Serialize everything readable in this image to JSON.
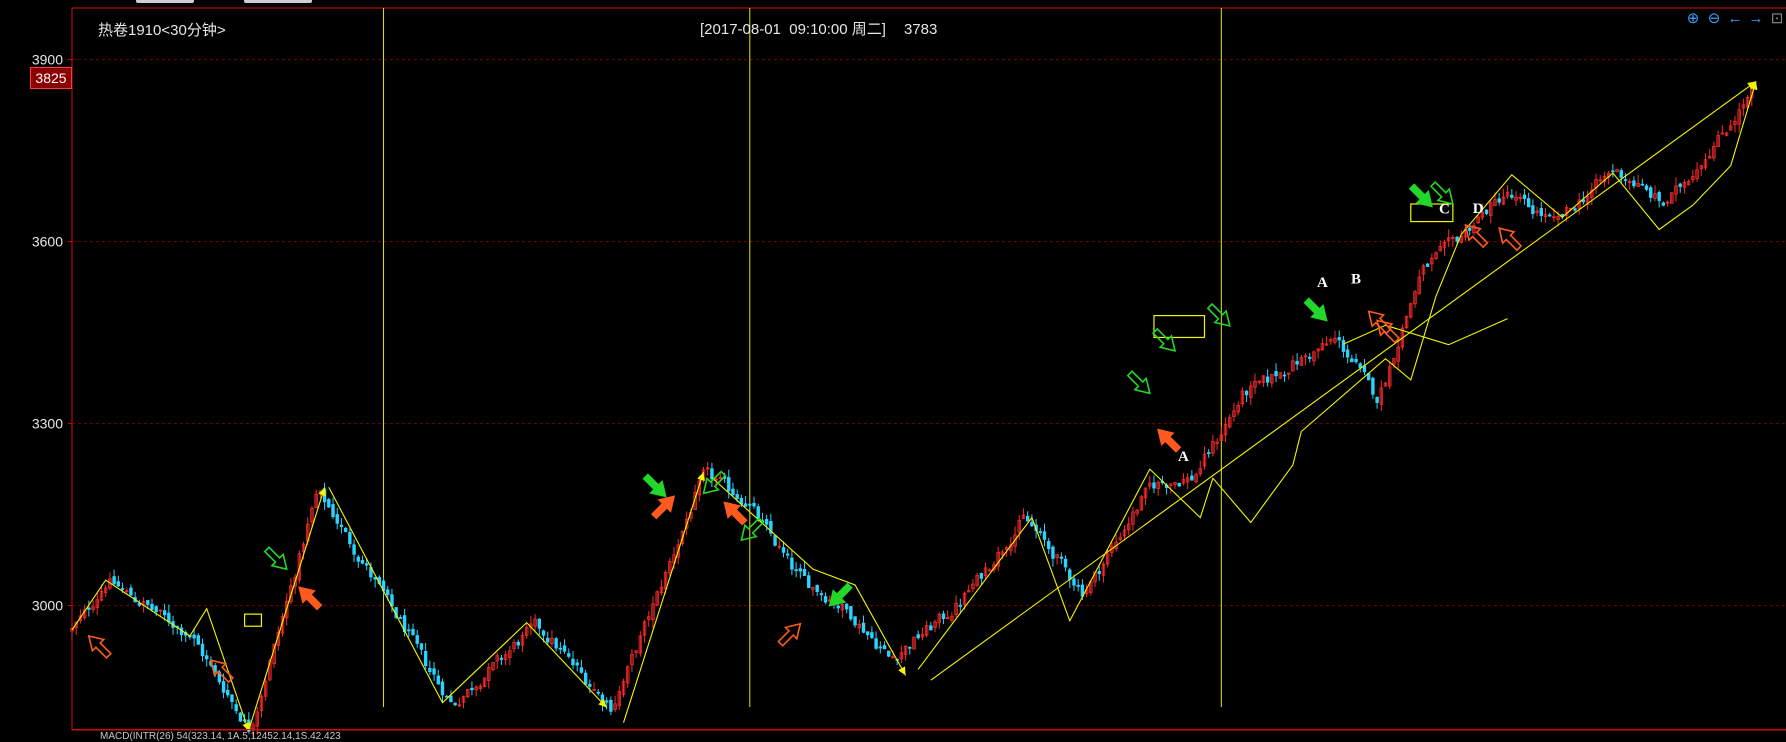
{
  "header": {
    "title": "热卷1910<30分钟>",
    "cursor_datetime": "[2017-08-01  09:10:00 周二]",
    "cursor_value": "3783",
    "current_price": "3825"
  },
  "colors": {
    "background": "#000000",
    "up": "#ff2a2a",
    "down": "#2ad4ff",
    "grid": "#7a0000",
    "zigzag": "#f5f500",
    "vline": "#e6e600",
    "arrow_green": "#22d62a",
    "arrow_orange": "#ff5a1e",
    "box": "#f5f500"
  },
  "toolbar": {
    "icons": [
      "zoom-in-icon",
      "zoom-out-icon",
      "arrow-left-icon",
      "arrow-right-icon",
      "restore-icon"
    ]
  },
  "annotations": {
    "letters": [
      {
        "text": "A",
        "i": 264,
        "price": 3238,
        "color": "#ffffff"
      },
      {
        "text": "A",
        "i": 297,
        "price": 3525,
        "color": "#ffffff"
      },
      {
        "text": "B",
        "i": 305,
        "price": 3531,
        "color": "#ffffff"
      },
      {
        "text": "C",
        "i": 326,
        "price": 3646,
        "color": "#ffffff"
      },
      {
        "text": "D",
        "i": 334,
        "price": 3647,
        "color": "#ffffff"
      }
    ]
  },
  "chart_data": {
    "type": "candlestick",
    "title": "",
    "ylim": [
      2795,
      3985
    ],
    "y_ticks": [
      3000,
      3300,
      3600,
      3900
    ],
    "grid": true,
    "candle_count": 400,
    "zigzag_anchors": [
      [
        0,
        2960
      ],
      [
        8,
        3042
      ],
      [
        28,
        2950
      ],
      [
        42,
        2793
      ],
      [
        58,
        3190
      ],
      [
        90,
        2835
      ],
      [
        110,
        2970
      ],
      [
        128,
        2830
      ],
      [
        150,
        3220
      ],
      [
        160,
        3170
      ],
      [
        172,
        3050
      ],
      [
        184,
        2990
      ],
      [
        194,
        2912
      ],
      [
        210,
        3000
      ],
      [
        226,
        3145
      ],
      [
        240,
        3020
      ],
      [
        256,
        3200
      ],
      [
        266,
        3210
      ],
      [
        278,
        3350
      ],
      [
        300,
        3440
      ],
      [
        310,
        3340
      ],
      [
        320,
        3550
      ],
      [
        340,
        3680
      ],
      [
        352,
        3630
      ],
      [
        366,
        3720
      ],
      [
        378,
        3660
      ],
      [
        392,
        3780
      ],
      [
        400,
        3860
      ]
    ],
    "zigzag_lines": [
      {
        "points": [
          [
            0,
            2960
          ],
          [
            8,
            3042
          ],
          [
            28,
            2950
          ],
          [
            32,
            2995
          ],
          [
            42,
            2793
          ]
        ],
        "arrow_end": true
      },
      {
        "points": [
          [
            42,
            2795
          ],
          [
            60,
            3195
          ]
        ],
        "arrow_end": true
      },
      {
        "points": [
          [
            61,
            3195
          ],
          [
            88,
            2840
          ],
          [
            108,
            2972
          ],
          [
            127,
            2832
          ]
        ],
        "arrow_end": true
      },
      {
        "points": [
          [
            131,
            2807
          ],
          [
            150,
            3220
          ]
        ],
        "arrow_end": true
      },
      {
        "points": [
          [
            152,
            3211
          ],
          [
            176,
            3060
          ],
          [
            186,
            3034
          ],
          [
            198,
            2885
          ]
        ],
        "arrow_end": true
      },
      {
        "points": [
          [
            201,
            2895
          ],
          [
            228,
            3145
          ],
          [
            237,
            2975
          ],
          [
            256,
            3225
          ],
          [
            268,
            3145
          ],
          [
            271,
            3210
          ],
          [
            280,
            3137
          ],
          [
            290,
            3232
          ],
          [
            292,
            3287
          ]
        ],
        "arrow_end": false
      },
      {
        "points": [
          [
            292,
            3287
          ],
          [
            312,
            3407
          ],
          [
            318,
            3372
          ],
          [
            324,
            3510
          ],
          [
            330,
            3612
          ]
        ],
        "arrow_end": false
      },
      {
        "points": [
          [
            330,
            3612
          ],
          [
            342,
            3710
          ],
          [
            354,
            3640
          ],
          [
            366,
            3713
          ],
          [
            377,
            3620
          ],
          [
            385,
            3660
          ],
          [
            394,
            3725
          ],
          [
            400,
            3864
          ]
        ],
        "arrow_end": true
      },
      {
        "points": [
          [
            204,
            2877
          ],
          [
            400,
            3864
          ]
        ],
        "arrow_end": true
      },
      {
        "points": [
          [
            302,
            3431
          ],
          [
            312,
            3462
          ],
          [
            327,
            3430
          ],
          [
            341,
            3473
          ]
        ],
        "arrow_end": false
      }
    ],
    "vertical_lines": [
      74,
      161,
      273
    ],
    "boxes": [
      {
        "i0": 41,
        "i1": 45,
        "p0": 2966,
        "p1": 2986
      },
      {
        "i0": 257,
        "i1": 269,
        "p0": 3442,
        "p1": 3478
      },
      {
        "i0": 318,
        "i1": 328,
        "p0": 3633,
        "p1": 3662
      }
    ],
    "arrows": [
      {
        "i": 4,
        "price": 2950,
        "dir": "up-left",
        "color": "#ff5a1e",
        "filled": false
      },
      {
        "i": 33,
        "price": 2910,
        "dir": "up-left",
        "color": "#ff5a1e",
        "filled": false
      },
      {
        "i": 51,
        "price": 3060,
        "dir": "down-right",
        "color": "#22d62a",
        "filled": false
      },
      {
        "i": 54,
        "price": 3030,
        "dir": "up-left",
        "color": "#ff5a1e",
        "filled": true
      },
      {
        "i": 141,
        "price": 3180,
        "dir": "down-right",
        "color": "#22d62a",
        "filled": true
      },
      {
        "i": 143,
        "price": 3180,
        "dir": "up-right",
        "color": "#ff5a1e",
        "filled": true
      },
      {
        "i": 150,
        "price": 3185,
        "dir": "down-left",
        "color": "#22d62a",
        "filled": false
      },
      {
        "i": 155,
        "price": 3170,
        "dir": "up-left",
        "color": "#ff5a1e",
        "filled": true
      },
      {
        "i": 159,
        "price": 3108,
        "dir": "down-left",
        "color": "#22d62a",
        "filled": false
      },
      {
        "i": 173,
        "price": 2970,
        "dir": "up-right",
        "color": "#ff5a1e",
        "filled": false
      },
      {
        "i": 180,
        "price": 3000,
        "dir": "down-left",
        "color": "#22d62a",
        "filled": true
      },
      {
        "i": 256,
        "price": 3350,
        "dir": "down-right",
        "color": "#22d62a",
        "filled": false
      },
      {
        "i": 258,
        "price": 3290,
        "dir": "up-left",
        "color": "#ff5a1e",
        "filled": true
      },
      {
        "i": 262,
        "price": 3420,
        "dir": "down-right",
        "color": "#22d62a",
        "filled": false
      },
      {
        "i": 275,
        "price": 3461,
        "dir": "down-right",
        "color": "#22d62a",
        "filled": false
      },
      {
        "i": 298,
        "price": 3470,
        "dir": "down-right",
        "color": "#22d62a",
        "filled": true
      },
      {
        "i": 308,
        "price": 3485,
        "dir": "up-left",
        "color": "#ff5a1e",
        "filled": false
      },
      {
        "i": 310,
        "price": 3470,
        "dir": "up-left",
        "color": "#ff5a1e",
        "filled": false
      },
      {
        "i": 323,
        "price": 3658,
        "dir": "down-right",
        "color": "#22d62a",
        "filled": true
      },
      {
        "i": 328,
        "price": 3662,
        "dir": "down-right",
        "color": "#22d62a",
        "filled": false
      },
      {
        "i": 331,
        "price": 3627,
        "dir": "up-left",
        "color": "#ff5a1e",
        "filled": false
      },
      {
        "i": 339,
        "price": 3622,
        "dir": "up-left",
        "color": "#ff5a1e",
        "filled": false
      }
    ]
  },
  "footer": {
    "indicator_text": "MACD(INTR(26) 54(323.14, 1A.5,12452.14,1S.42.423"
  }
}
